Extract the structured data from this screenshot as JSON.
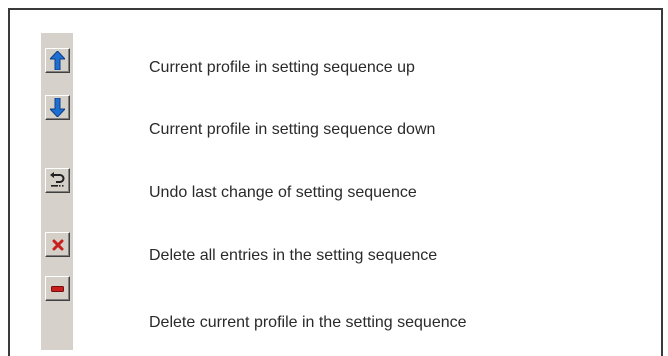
{
  "actions": [
    {
      "icon": "arrow-up-icon",
      "description": "Current profile in setting sequence up",
      "color": "#1e6fd0"
    },
    {
      "icon": "arrow-down-icon",
      "description": "Current profile in setting sequence down",
      "color": "#1e6fd0"
    },
    {
      "icon": "undo-icon",
      "description": "Undo last change of setting sequence",
      "color": "#303030"
    },
    {
      "icon": "delete-all-icon",
      "description": "Delete all entries in the setting sequence",
      "color": "#c81e1e"
    },
    {
      "icon": "minus-icon",
      "description": "Delete current profile in the setting sequence",
      "color": "#c81e1e"
    }
  ]
}
